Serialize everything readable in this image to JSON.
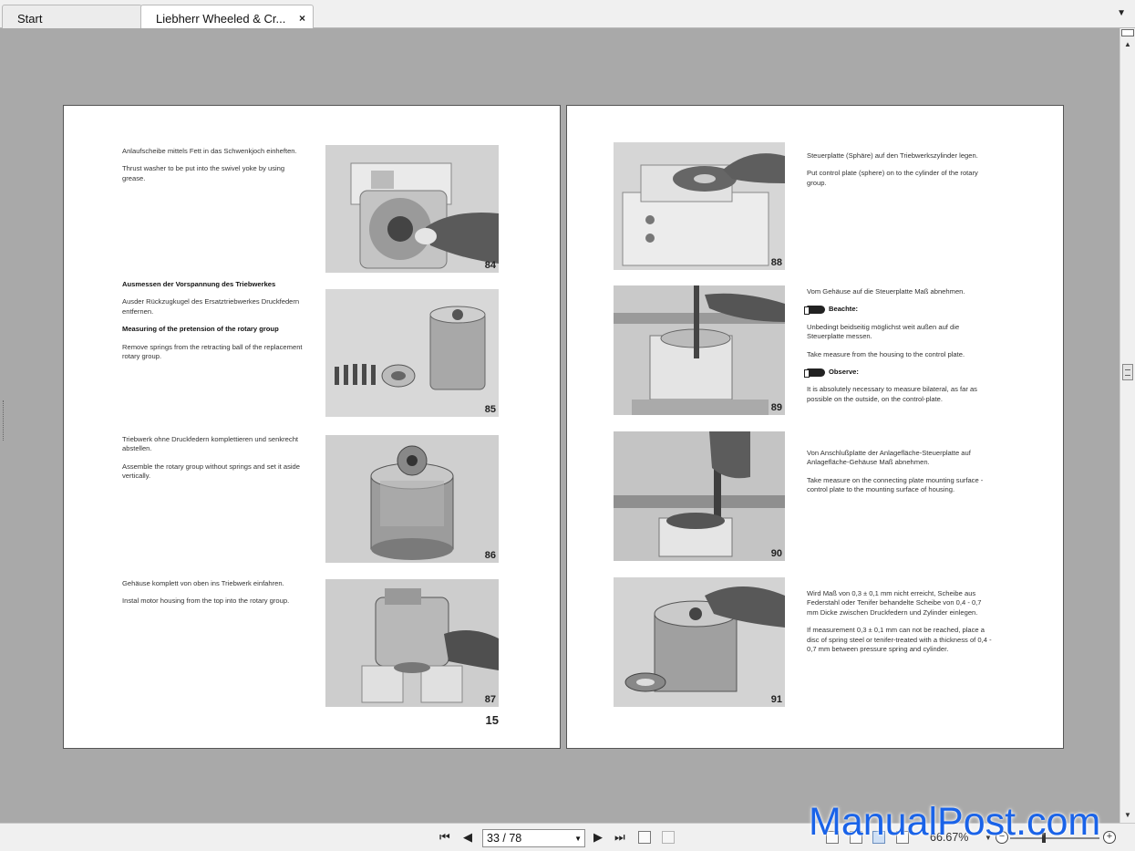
{
  "tabs": [
    {
      "label": "Start"
    },
    {
      "label": "Liebherr Wheeled & Cr...",
      "close": "×"
    }
  ],
  "left_page": {
    "sections": [
      {
        "paragraphs": [
          {
            "text": "Anlaufscheibe mittels Fett in das Schwenkjoch einheften."
          },
          {
            "text": "Thrust washer to be put into the swivel yoke by using grease."
          }
        ]
      },
      {
        "paragraphs": [
          {
            "text": "Ausmessen der Vorspannung des Triebwerkes",
            "bold": true
          },
          {
            "text": "Ausder Rückzugkugel des Ersatztriebwerkes Druckfedern entfernen."
          },
          {
            "text": "Measuring of the pretension of the rotary group",
            "bold": true
          },
          {
            "text": "Remove springs from the retracting ball of the replacement rotary group."
          }
        ]
      },
      {
        "paragraphs": [
          {
            "text": "Triebwerk ohne Druckfedern komplettieren und senkrecht abstellen."
          },
          {
            "text": "Assemble the rotary group without springs and set it aside vertically."
          }
        ]
      },
      {
        "paragraphs": [
          {
            "text": "Gehäuse komplett von oben ins Triebwerk einfahren."
          },
          {
            "text": "Instal motor housing from the top into the rotary group."
          }
        ]
      }
    ],
    "figures": [
      "84",
      "85",
      "86",
      "87"
    ],
    "page_number": "15"
  },
  "right_page": {
    "sections": [
      {
        "paragraphs": [
          {
            "text": "Steuerplatte (Sphäre) auf den Triebwerkszylinder legen."
          },
          {
            "text": "Put control plate (sphere) on to the cylinder of the rotary group."
          }
        ]
      },
      {
        "paragraphs": [
          {
            "text": "Vom Gehäuse auf die Steuerplatte Maß abnehmen."
          },
          {
            "text": "Beachte:",
            "note": true
          },
          {
            "text": "Unbedingt beidseitig möglichst weit außen auf die Steuerplatte messen."
          },
          {
            "text": "Take measure from the housing to the control plate."
          },
          {
            "text": "Observe:",
            "note": true
          },
          {
            "text": "It is absolutely necessary to measure bilateral, as far as possible on the outside, on the control-plate."
          }
        ]
      },
      {
        "paragraphs": [
          {
            "text": "Von Anschlußplatte der Anlagefläche-Steuerplatte auf Anlagefläche-Gehäuse Maß abnehmen."
          },
          {
            "text": "Take measure on the connecting plate mounting surface - control plate to the mounting surface of housing."
          }
        ]
      },
      {
        "paragraphs": [
          {
            "text": "Wird Maß von 0,3 ± 0,1 mm nicht erreicht, Scheibe aus Federstahl oder Tenifer behandelte Scheibe von 0,4 - 0,7 mm Dicke zwischen Druckfedern und Zylinder einlegen."
          },
          {
            "text": "If measurement 0,3 ± 0,1 mm can not be reached, place a disc of spring steel or tenifer-treated with a thickness of 0,4 - 0,7 mm between pressure spring and cylinder."
          }
        ]
      }
    ],
    "figures": [
      "88",
      "89",
      "90",
      "91"
    ]
  },
  "toolbar": {
    "page_value": "33 / 78",
    "zoom": "66.67%"
  },
  "watermark": "ManualPost.com"
}
